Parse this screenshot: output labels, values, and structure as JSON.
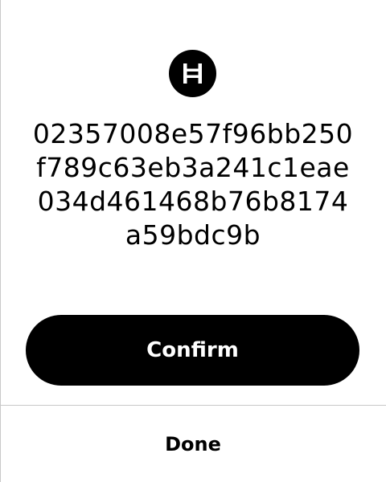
{
  "logo": {
    "icon": "hedera-h-icon",
    "background_color": "#000000",
    "glyph_color": "#ffffff"
  },
  "key": {
    "lines": [
      "02357008e57f96bb250",
      "f789c63eb3a241c1eae",
      "034d461468b76b8174",
      "a59bdc9b"
    ]
  },
  "actions": {
    "confirm_label": "Confirm",
    "done_label": "Done"
  },
  "colors": {
    "primary": "#000000",
    "on_primary": "#ffffff",
    "divider": "#c8c8c8"
  }
}
